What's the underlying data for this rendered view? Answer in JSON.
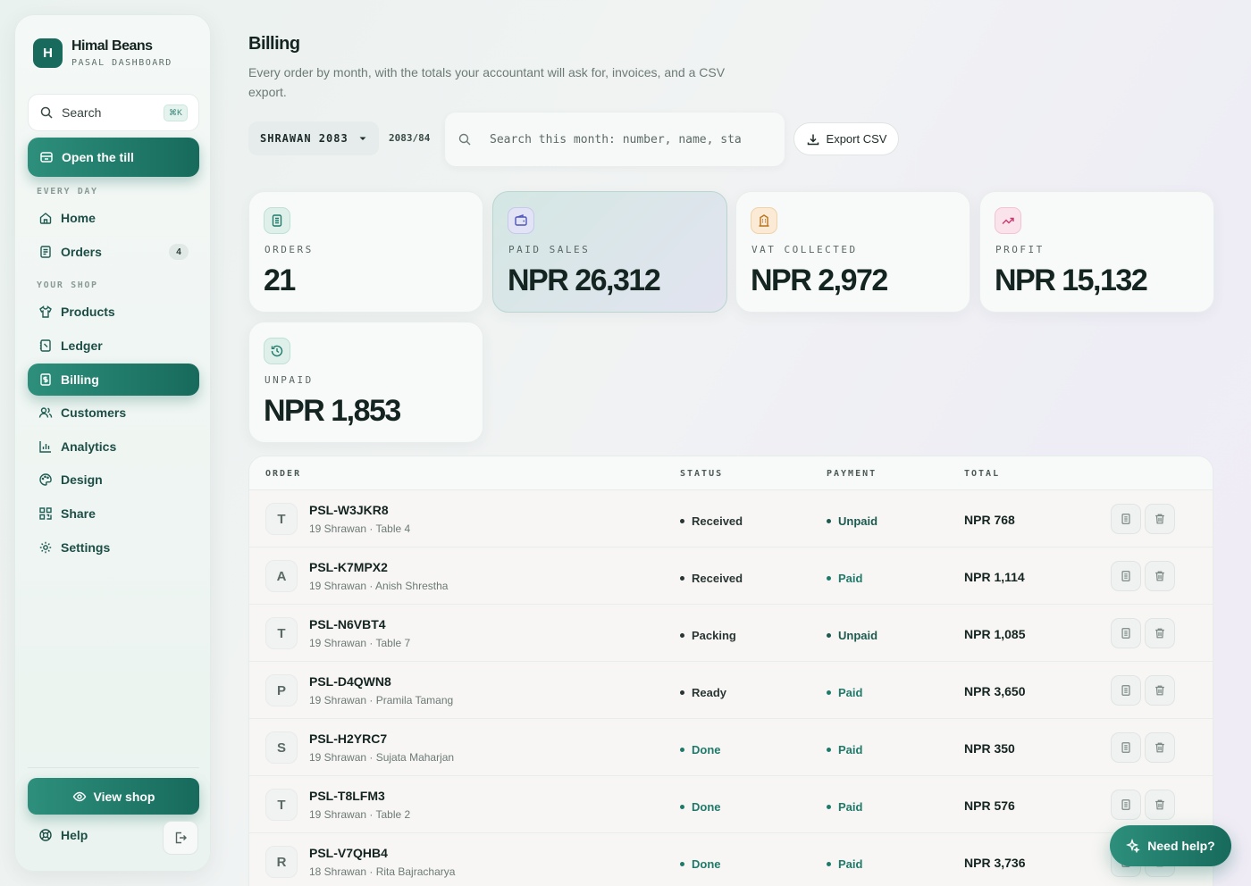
{
  "brand": {
    "initial": "H",
    "name": "Himal Beans",
    "subtitle": "PASAL DASHBOARD"
  },
  "sidebar": {
    "search_label": "Search",
    "search_shortcut": "⌘K",
    "till_label": "Open the till",
    "section_everyday": "EVERY DAY",
    "section_shop": "YOUR SHOP",
    "items": [
      {
        "label": "Home",
        "icon": "home-icon"
      },
      {
        "label": "Orders",
        "icon": "receipt-icon",
        "badge": "4"
      },
      {
        "label": "Products",
        "icon": "shirt-icon"
      },
      {
        "label": "Ledger",
        "icon": "notebook-icon"
      },
      {
        "label": "Billing",
        "icon": "billing-icon",
        "active": true
      },
      {
        "label": "Customers",
        "icon": "users-icon"
      },
      {
        "label": "Analytics",
        "icon": "bar-chart-icon"
      },
      {
        "label": "Design",
        "icon": "palette-icon"
      },
      {
        "label": "Share",
        "icon": "qr-code-icon"
      },
      {
        "label": "Settings",
        "icon": "gear-icon"
      }
    ],
    "view_shop_label": "View shop",
    "help_label": "Help"
  },
  "header": {
    "title": "Billing",
    "subtitle": "Every order by month, with the totals your accountant will ask for, invoices, and a CSV export."
  },
  "toolbar": {
    "month": "SHRAWAN 2083",
    "fiscal_year": "2083/84",
    "search_placeholder": "Search this month: number, name, sta",
    "export_label": "Export CSV"
  },
  "stats": [
    {
      "label": "ORDERS",
      "value": "21",
      "icon": "document-icon",
      "color": "#1f7a6a"
    },
    {
      "label": "PAID SALES",
      "value": "NPR 26,312",
      "icon": "wallet-icon",
      "color": "#4f56b8"
    },
    {
      "label": "VAT COLLECTED",
      "value": "NPR 2,972",
      "icon": "building-icon",
      "color": "#b8741f"
    },
    {
      "label": "PROFIT",
      "value": "NPR 15,132",
      "icon": "trend-up-icon",
      "color": "#c83a6e"
    },
    {
      "label": "UNPAID",
      "value": "NPR 1,853",
      "icon": "history-icon",
      "color": "#1f7a6a"
    }
  ],
  "table": {
    "headers": {
      "order": "ORDER",
      "status": "STATUS",
      "payment": "PAYMENT",
      "total": "TOTAL"
    },
    "rows": [
      {
        "initial": "T",
        "number": "PSL-W3JKR8",
        "meta": "19 Shrawan · Table 4",
        "status": "Received",
        "payment": "Unpaid",
        "total": "NPR 768"
      },
      {
        "initial": "A",
        "number": "PSL-K7MPX2",
        "meta": "19 Shrawan · Anish Shrestha",
        "status": "Received",
        "payment": "Paid",
        "total": "NPR 1,114"
      },
      {
        "initial": "T",
        "number": "PSL-N6VBT4",
        "meta": "19 Shrawan · Table 7",
        "status": "Packing",
        "payment": "Unpaid",
        "total": "NPR 1,085"
      },
      {
        "initial": "P",
        "number": "PSL-D4QWN8",
        "meta": "19 Shrawan · Pramila Tamang",
        "status": "Ready",
        "payment": "Paid",
        "total": "NPR 3,650"
      },
      {
        "initial": "S",
        "number": "PSL-H2YRC7",
        "meta": "19 Shrawan · Sujata Maharjan",
        "status": "Done",
        "payment": "Paid",
        "total": "NPR 350"
      },
      {
        "initial": "T",
        "number": "PSL-T8LFM3",
        "meta": "19 Shrawan · Table 2",
        "status": "Done",
        "payment": "Paid",
        "total": "NPR 576"
      },
      {
        "initial": "R",
        "number": "PSL-V7QHB4",
        "meta": "18 Shrawan · Rita Bajracharya",
        "status": "Done",
        "payment": "Paid",
        "total": "NPR 3,736"
      }
    ]
  },
  "colors": {
    "accent": "#176a5c",
    "status_pending": "#2a3633",
    "status_done": "#1f7a6a",
    "payment_paid": "#1f7a6a",
    "payment_unpaid": "#1d5a4f"
  },
  "need_help_label": "Need help?"
}
